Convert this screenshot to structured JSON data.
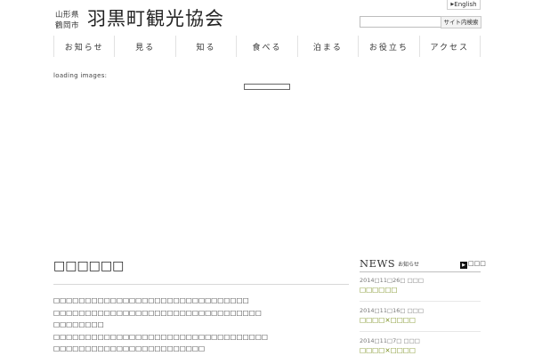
{
  "header": {
    "prefecture": "山形県",
    "city": "鶴岡市",
    "site_name": "羽黒町観光協会",
    "lang_link": "English",
    "search_input_value": "",
    "search_button": "サイト内検索"
  },
  "nav": {
    "items": [
      {
        "label": "お知らせ"
      },
      {
        "label": "見る"
      },
      {
        "label": "知る"
      },
      {
        "label": "食べる"
      },
      {
        "label": "泊まる"
      },
      {
        "label": "お役立ち"
      },
      {
        "label": "アクセス"
      }
    ]
  },
  "loading": {
    "text": "loading images:",
    "progress": 0
  },
  "main": {
    "title": "□□□□□□",
    "paragraph_lines": [
      "□□□□□□□□□□□□□□□□□□□□□□□□□□□□□□□",
      "□□□□□□□□□□□□□□□□□□□□□□□□□□□□□□□□□",
      "□□□□□□□□",
      "□□□□□□□□□□□□□□□□□□□□□□□□□□□□□□□□□□",
      "□□□□□□□□□□□□□□□□□□□□□□□□"
    ]
  },
  "news": {
    "heading": "NEWS",
    "subheading": "お知らせ",
    "more": "□□□",
    "items": [
      {
        "date": "2014□11□26□ □□□",
        "title": "□□□□□□"
      },
      {
        "date": "2014□11□16□ □□□",
        "title": "□□□□×□□□□"
      },
      {
        "date": "2014□11□7□ □□□",
        "title": "□□□□×□□□□"
      }
    ]
  }
}
